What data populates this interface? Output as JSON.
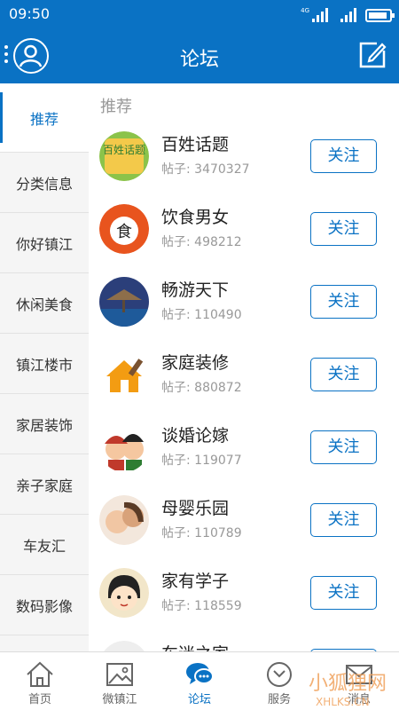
{
  "status_bar": {
    "time": "09:50",
    "network": "4G",
    "battery_level": 0.9
  },
  "header": {
    "title": "论坛"
  },
  "sidebar": {
    "items": [
      {
        "label": "推荐",
        "active": true
      },
      {
        "label": "分类信息"
      },
      {
        "label": "你好镇江"
      },
      {
        "label": "休闲美食"
      },
      {
        "label": "镇江楼市"
      },
      {
        "label": "家居装饰"
      },
      {
        "label": "亲子家庭"
      },
      {
        "label": "车友汇"
      },
      {
        "label": "数码影像"
      }
    ]
  },
  "main": {
    "section_title": "推荐",
    "forums": [
      {
        "name": "百姓话题",
        "posts": "帖子: 3470327",
        "follow": "关注"
      },
      {
        "name": "饮食男女",
        "posts": "帖子: 498212",
        "follow": "关注"
      },
      {
        "name": "畅游天下",
        "posts": "帖子: 110490",
        "follow": "关注"
      },
      {
        "name": "家庭装修",
        "posts": "帖子: 880872",
        "follow": "关注"
      },
      {
        "name": "谈婚论嫁",
        "posts": "帖子: 119077",
        "follow": "关注"
      },
      {
        "name": "母婴乐园",
        "posts": "帖子: 110789",
        "follow": "关注"
      },
      {
        "name": "家有学子",
        "posts": "帖子: 118559",
        "follow": "关注"
      },
      {
        "name": "车迷之家",
        "posts": "",
        "follow": "关注"
      }
    ]
  },
  "tabbar": {
    "tabs": [
      {
        "label": "首页",
        "icon": "home-icon"
      },
      {
        "label": "微镇江",
        "icon": "image-icon"
      },
      {
        "label": "论坛",
        "icon": "chat-icon",
        "active": true
      },
      {
        "label": "服务",
        "icon": "service-icon"
      },
      {
        "label": "消息",
        "icon": "mail-icon"
      }
    ]
  },
  "thumb_icons": {
    "baixing": "百姓话题",
    "food": "食"
  },
  "watermark": {
    "cn": "小狐狸网",
    "en": "XHLKS.CN"
  },
  "colors": {
    "primary": "#0a72c4",
    "muted": "#999999",
    "sidebar_bg": "#f5f5f5"
  }
}
